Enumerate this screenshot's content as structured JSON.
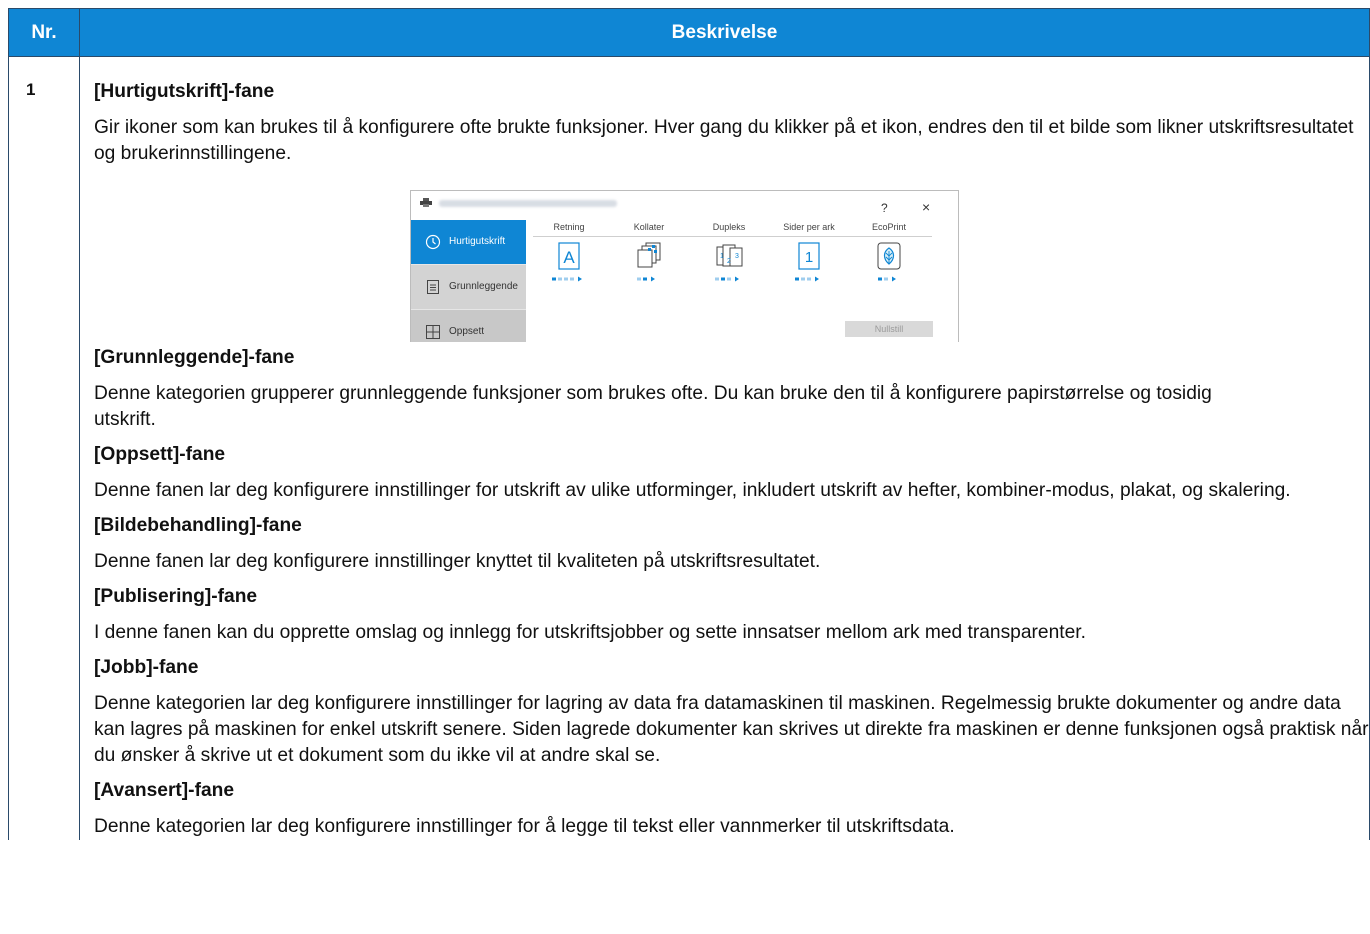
{
  "table": {
    "headers": {
      "nr": "Nr.",
      "description": "Beskrivelse"
    },
    "row": {
      "nr": "1",
      "sections": [
        {
          "title": "[Hurtigutskrift]-fane",
          "body": "Gir ikoner som kan brukes til å konfigurere ofte brukte funksjoner. Hver gang du klikker på et ikon, endres den til et bilde som likner utskriftsresultatet og brukerinnstillingene."
        },
        {
          "title": "[Grunnleggende]-fane",
          "body": "Denne kategorien grupperer grunnleggende funksjoner som brukes ofte. Du kan bruke den til å konfigurere papirstørrelse og tosidig utskrift."
        },
        {
          "title": "[Oppsett]-fane",
          "body": "Denne fanen lar deg konfigurere innstillinger for utskrift av ulike utforminger, inkludert utskrift av hefter, kombiner-modus, plakat, og skalering."
        },
        {
          "title": "[Bildebehandling]-fane",
          "body": "Denne fanen lar deg konfigurere innstillinger knyttet til kvaliteten på utskriftsresultatet."
        },
        {
          "title": "[Publisering]-fane",
          "body": "I denne fanen kan du opprette omslag og innlegg for utskriftsjobber og sette innsatser mellom ark med transparenter."
        },
        {
          "title": "[Jobb]-fane",
          "body": "Denne kategorien lar deg konfigurere innstillinger for lagring av data fra datamaskinen til maskinen. Regelmessig brukte dokumenter og andre data kan lagres på maskinen for enkel utskrift senere. Siden lagrede dokumenter kan skrives ut direkte fra maskinen er denne funksjonen også praktisk når du ønsker å skrive ut et dokument som du ikke vil at andre skal se."
        },
        {
          "title": "[Avansert]-fane",
          "body": "Denne kategorien lar deg konfigurere innstillinger for å legge til tekst eller vannmerker til utskriftsdata."
        }
      ]
    }
  },
  "dialog": {
    "help_label": "?",
    "close_label": "×",
    "sidebar": [
      {
        "label": "Hurtigutskrift",
        "icon": "clock-icon",
        "active": true
      },
      {
        "label": "Grunnleggende",
        "icon": "document-icon",
        "active": false
      },
      {
        "label": "Oppsett",
        "icon": "layout-grid-icon",
        "active": false
      }
    ],
    "columns": [
      {
        "label": "Retning",
        "icon": "orientation-icon",
        "glyph": "A"
      },
      {
        "label": "Kollater",
        "icon": "collate-icon"
      },
      {
        "label": "Dupleks",
        "icon": "duplex-icon"
      },
      {
        "label": "Sider per ark",
        "icon": "pages-per-sheet-icon",
        "glyph": "1"
      },
      {
        "label": "EcoPrint",
        "icon": "ecoprint-leaf-icon"
      }
    ],
    "reset_label": "Nullstill"
  },
  "colors": {
    "header_bg": "#0f86d4",
    "header_text": "#ffffff",
    "accent": "#0f86d4",
    "border": "#2a4a6a"
  }
}
